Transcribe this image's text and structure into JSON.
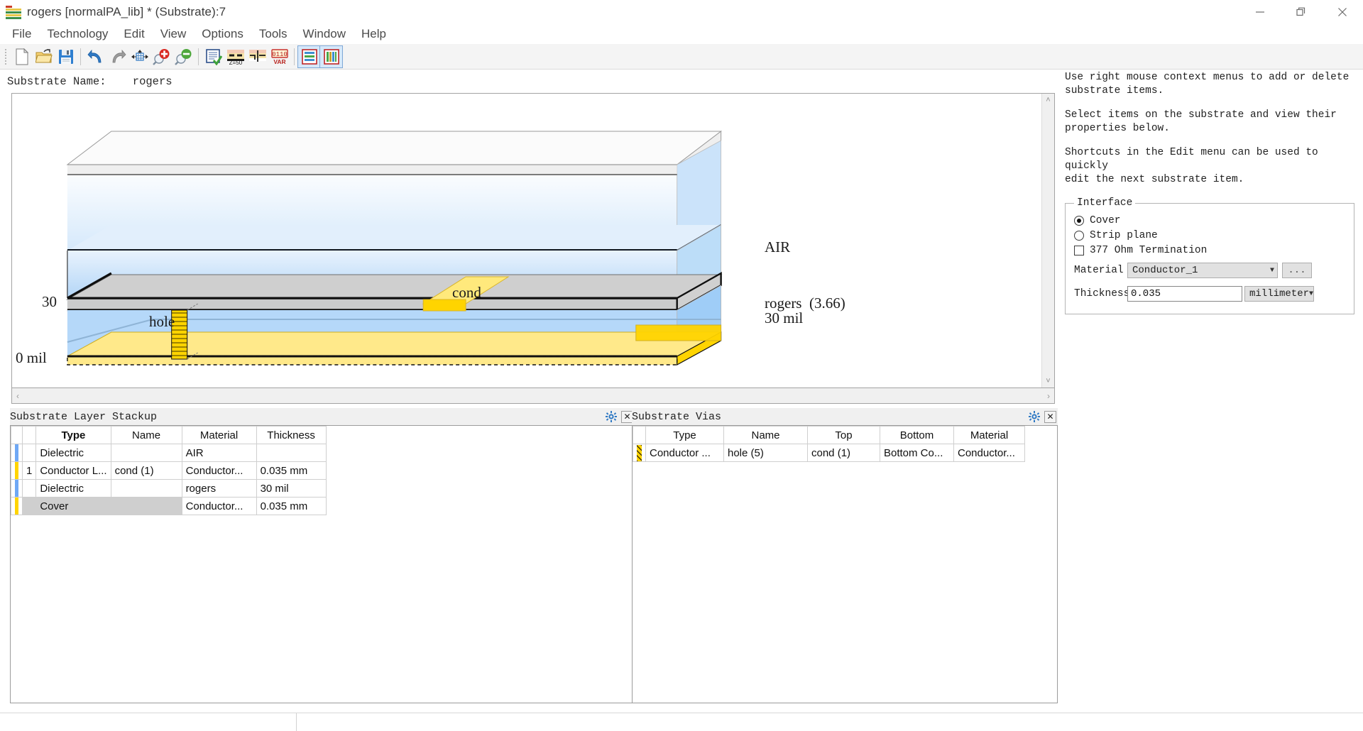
{
  "window": {
    "title": "rogers [normalPA_lib] * (Substrate):7",
    "icon": "substrate-stack-icon",
    "controls": [
      {
        "name": "minimize-button",
        "glyph": "minimize-icon"
      },
      {
        "name": "maximize-button",
        "glyph": "restore-icon"
      },
      {
        "name": "close-button",
        "glyph": "close-icon"
      }
    ]
  },
  "menubar": {
    "items": [
      {
        "label": "File",
        "name": "menu-file"
      },
      {
        "label": "Technology",
        "name": "menu-technology"
      },
      {
        "label": "Edit",
        "name": "menu-edit"
      },
      {
        "label": "View",
        "name": "menu-view"
      },
      {
        "label": "Options",
        "name": "menu-options"
      },
      {
        "label": "Tools",
        "name": "menu-tools"
      },
      {
        "label": "Window",
        "name": "menu-window"
      },
      {
        "label": "Help",
        "name": "menu-help"
      }
    ]
  },
  "toolbar": {
    "buttons": [
      {
        "name": "new-file-button",
        "icon": "new-document-icon",
        "tooltip": "New"
      },
      {
        "name": "open-file-button",
        "icon": "open-folder-icon",
        "tooltip": "Open"
      },
      {
        "name": "save-button",
        "icon": "floppy-disk-icon",
        "tooltip": "Save"
      },
      {
        "name": "undo-button",
        "icon": "undo-arrow-icon",
        "tooltip": "Undo"
      },
      {
        "name": "redo-button",
        "icon": "redo-arrow-icon",
        "tooltip": "Redo"
      },
      {
        "name": "zoom-fit-button",
        "icon": "zoom-fit-grid-icon",
        "tooltip": "Zoom to fit"
      },
      {
        "name": "zoom-in-button",
        "icon": "magnifier-plus-icon",
        "tooltip": "Zoom in"
      },
      {
        "name": "zoom-out-button",
        "icon": "magnifier-minus-icon",
        "tooltip": "Zoom out"
      },
      {
        "name": "check-substrate-button",
        "icon": "clipboard-check-icon",
        "tooltip": "Verify"
      },
      {
        "name": "impedance-button",
        "icon": "z50-stackup-icon",
        "tooltip": "Z=50"
      },
      {
        "name": "layer-map-button",
        "icon": "layer-map-icon",
        "tooltip": "Layer mapping"
      },
      {
        "name": "variables-button",
        "icon": "var-0110-icon",
        "tooltip": "VAR"
      },
      {
        "name": "stackup-view-button",
        "icon": "horizontal-stackup-icon",
        "tooltip": "Stackup view",
        "selected": true
      },
      {
        "name": "vias-view-button",
        "icon": "vertical-bars-icon",
        "tooltip": "Vias view",
        "selected": true
      }
    ]
  },
  "substrate": {
    "name_label": "Substrate Name:",
    "name_value": "rogers",
    "diagram": {
      "labels": [
        {
          "name": "diagram-label-air",
          "text": "AIR"
        },
        {
          "name": "diagram-label-cond",
          "text": "cond"
        },
        {
          "name": "diagram-label-hole",
          "text": "hole"
        },
        {
          "name": "diagram-label-rogers",
          "text": "rogers  (3.66)"
        },
        {
          "name": "diagram-label-thickness",
          "text": "30 mil"
        },
        {
          "name": "diagram-label-top-height",
          "text": "30"
        },
        {
          "name": "diagram-label-bottom-height",
          "text": "0 mil"
        }
      ]
    },
    "scroll": {
      "up": "˄",
      "down": "˅",
      "left": "‹",
      "right": "›"
    }
  },
  "help": {
    "paragraphs": [
      "Use right mouse context menus to add or delete\nsubstrate items.",
      "Select items on the substrate and view their\nproperties below.",
      "Shortcuts in the Edit menu can be used to quickly\nedit the next substrate item."
    ]
  },
  "interface": {
    "legend": "Interface",
    "cover_label": "Cover",
    "strip_plane_label": "Strip plane",
    "termination_label": "377 Ohm Termination",
    "selected_radio": "Cover",
    "termination_checked": false,
    "material_label": "Material",
    "material_value": "Conductor_1",
    "material_more_button": "...",
    "thickness_label": "Thickness",
    "thickness_value": "0.035",
    "thickness_unit": "millimeter"
  },
  "stackup_panel": {
    "title": "Substrate Layer Stackup",
    "settings_icon": "gear-icon",
    "close_icon": "close-icon",
    "columns": [
      "",
      "",
      "Type",
      "Name",
      "Material",
      "Thickness"
    ],
    "rows": [
      {
        "swatch": "#6fa8f5",
        "index": "",
        "type": "Dielectric",
        "name": "",
        "material": "AIR",
        "thickness": "",
        "selected": false
      },
      {
        "swatch": "#ffd400",
        "index": "1",
        "type": "Conductor L...",
        "name": "cond (1)",
        "material": "Conductor...",
        "thickness": "0.035 mm",
        "selected": false
      },
      {
        "swatch": "#6fa8f5",
        "index": "",
        "type": "Dielectric",
        "name": "",
        "material": "rogers",
        "thickness": "30 mil",
        "selected": false
      },
      {
        "swatch": "#ffd400",
        "index": "",
        "type": "Cover",
        "name": "",
        "material": "Conductor...",
        "thickness": "0.035 mm",
        "selected": true
      }
    ]
  },
  "vias_panel": {
    "title": "Substrate Vias",
    "settings_icon": "gear-icon",
    "close_icon": "close-icon",
    "columns": [
      "",
      "Type",
      "Name",
      "Top",
      "Bottom",
      "Material"
    ],
    "rows": [
      {
        "swatch": "hatch-yellow",
        "type": "Conductor ...",
        "name": "hole (5)",
        "top": "cond (1)",
        "bottom": "Bottom Co...",
        "material": "Conductor..."
      }
    ]
  },
  "colors": {
    "accent_blue": "#6fa8f5",
    "conductor_yellow": "#ffd400",
    "dielectric_fill": "#b3d5f7",
    "air_fill": "#e8f2fd",
    "panel_bg": "#f0f0f0"
  }
}
